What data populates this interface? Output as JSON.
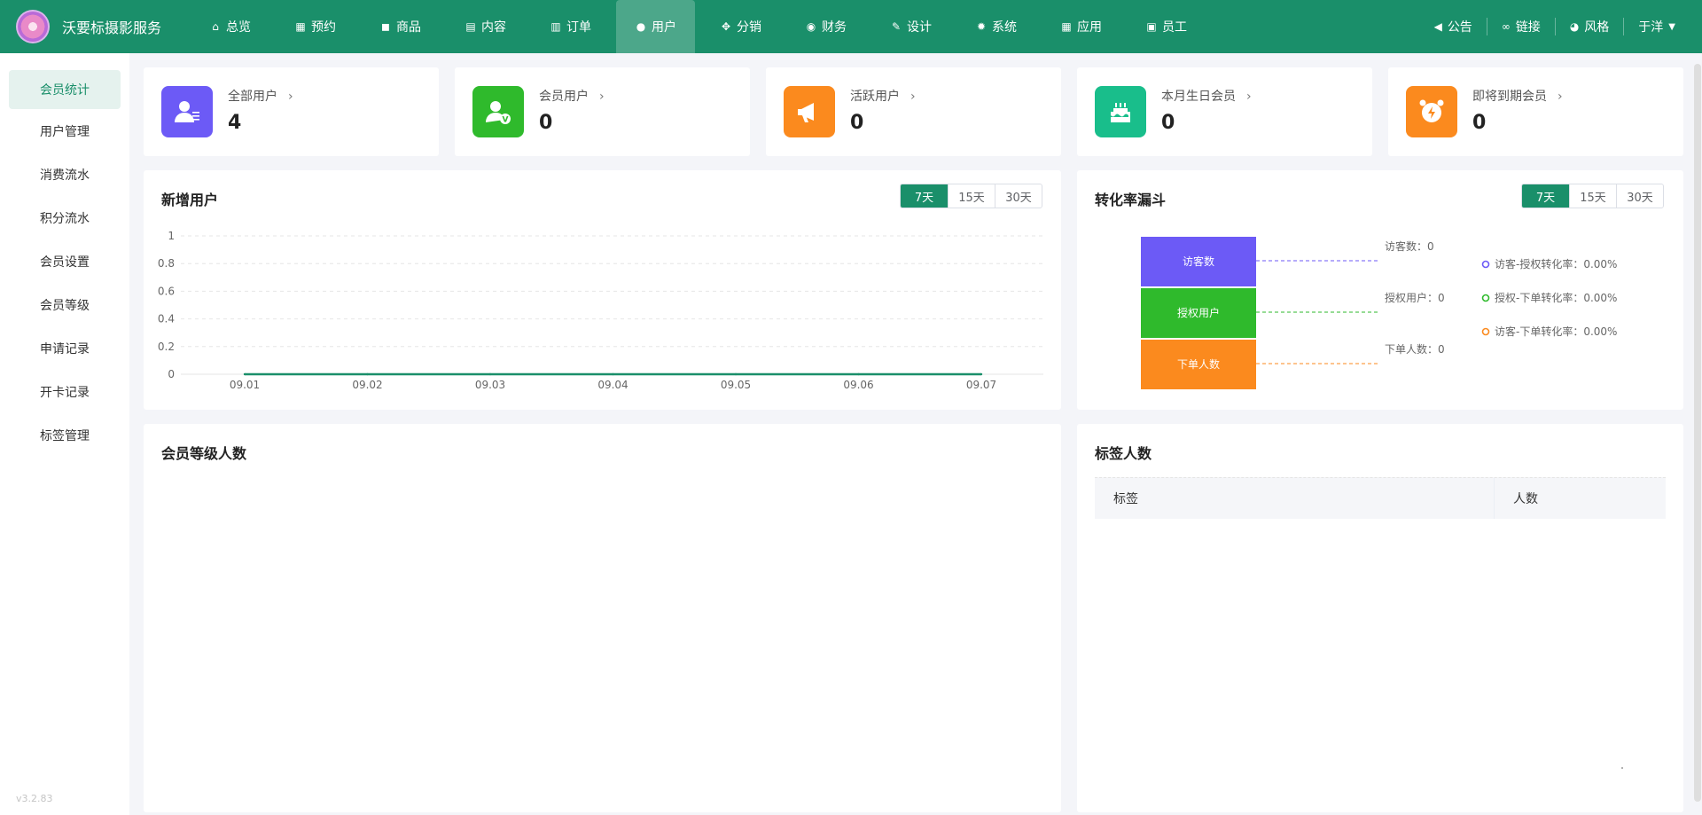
{
  "brand": {
    "name": "沃要标摄影服务"
  },
  "nav": [
    {
      "label": "总览",
      "icon": "home-icon",
      "glyph": "⌂"
    },
    {
      "label": "预约",
      "icon": "calendar-icon",
      "glyph": "▦"
    },
    {
      "label": "商品",
      "icon": "bag-icon",
      "glyph": "◼"
    },
    {
      "label": "内容",
      "icon": "document-icon",
      "glyph": "▤"
    },
    {
      "label": "订单",
      "icon": "clipboard-icon",
      "glyph": "▥"
    },
    {
      "label": "用户",
      "icon": "user-icon",
      "glyph": "●"
    },
    {
      "label": "分销",
      "icon": "share-icon",
      "glyph": "✥"
    },
    {
      "label": "财务",
      "icon": "money-bag-icon",
      "glyph": "◉"
    },
    {
      "label": "设计",
      "icon": "brush-icon",
      "glyph": "✎"
    },
    {
      "label": "系统",
      "icon": "gear-icon",
      "glyph": "✹"
    },
    {
      "label": "应用",
      "icon": "apps-icon",
      "glyph": "▦"
    },
    {
      "label": "员工",
      "icon": "lock-icon",
      "glyph": "▣"
    }
  ],
  "nav_active_index": 5,
  "header_right": {
    "announce": "公告",
    "link": "链接",
    "style": "风格",
    "user": "于洋"
  },
  "sidebar": {
    "items": [
      "会员统计",
      "用户管理",
      "消费流水",
      "积分流水",
      "会员设置",
      "会员等级",
      "申请记录",
      "开卡记录",
      "标签管理"
    ],
    "active_index": 0,
    "version": "v3.2.83"
  },
  "stats": [
    {
      "title": "全部用户",
      "value": "4",
      "color": "#6c5af6",
      "icon": "user-list-icon"
    },
    {
      "title": "会员用户",
      "value": "0",
      "color": "#2fba2c",
      "icon": "member-verified-icon"
    },
    {
      "title": "活跃用户",
      "value": "0",
      "color": "#fb8a1e",
      "icon": "megaphone-icon"
    },
    {
      "title": "本月生日会员",
      "value": "0",
      "color": "#19be8b",
      "icon": "birthday-cake-icon"
    },
    {
      "title": "即将到期会员",
      "value": "0",
      "color": "#fb8a1e",
      "icon": "alarm-clock-icon"
    }
  ],
  "new_users": {
    "title": "新增用户",
    "ranges": [
      "7天",
      "15天",
      "30天"
    ],
    "active_range": 0
  },
  "funnel": {
    "title": "转化率漏斗",
    "ranges": [
      "7天",
      "15天",
      "30天"
    ],
    "active_range": 0,
    "stages": [
      {
        "label": "访客数",
        "caption": "访客数：0",
        "color": "#6c5af6"
      },
      {
        "label": "授权用户",
        "caption": "授权用户：0",
        "color": "#2fba2c"
      },
      {
        "label": "下单人数",
        "caption": "下单人数：0",
        "color": "#fb8a1e"
      }
    ],
    "legend": [
      {
        "text": "访客-授权转化率：0.00%",
        "color": "#6c5af6"
      },
      {
        "text": "授权-下单转化率：0.00%",
        "color": "#2fba2c"
      },
      {
        "text": "访客-下单转化率：0.00%",
        "color": "#fb8a1e"
      }
    ]
  },
  "member_levels": {
    "title": "会员等级人数"
  },
  "tag_count": {
    "title": "标签人数",
    "columns": [
      "标签",
      "人数"
    ]
  },
  "chart_data": {
    "type": "line",
    "x": [
      "09.01",
      "09.02",
      "09.03",
      "09.04",
      "09.05",
      "09.06",
      "09.07"
    ],
    "series": [
      {
        "values": [
          0,
          0,
          0,
          0,
          0,
          0,
          0
        ]
      }
    ],
    "yticks": [
      "1",
      "0.8",
      "0.6",
      "0.4",
      "0.2",
      "0"
    ],
    "ylim": [
      0,
      1
    ],
    "grid": true,
    "color": "#1a8f6a"
  }
}
